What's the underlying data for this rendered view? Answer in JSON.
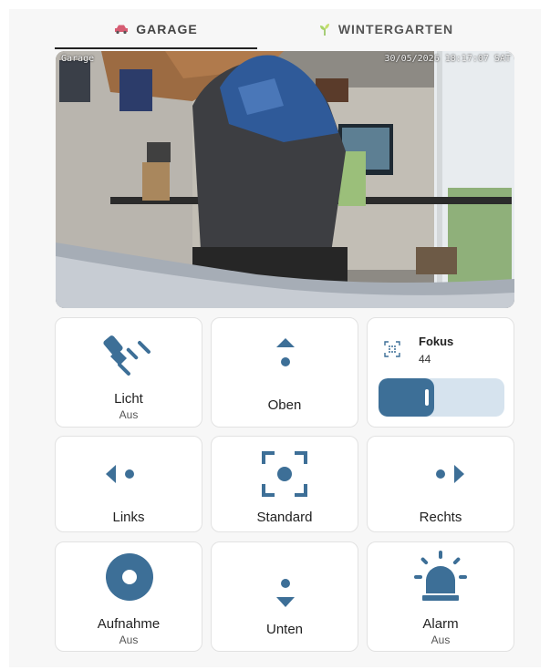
{
  "tabs": [
    {
      "label": "GARAGE",
      "icon": "car-icon",
      "active": true
    },
    {
      "label": "WINTERGARTEN",
      "icon": "plant-icon",
      "active": false
    }
  ],
  "camera": {
    "name": "Garage",
    "timestamp": "30/05/2026 18:17:07 SAT"
  },
  "controls": {
    "licht": {
      "label": "Licht",
      "state": "Aus",
      "icon": "flashlight-icon"
    },
    "oben": {
      "label": "Oben",
      "icon": "arrow-up-icon"
    },
    "fokus": {
      "label": "Fokus",
      "value": "44",
      "icon": "focus-icon",
      "level_percent": 44
    },
    "links": {
      "label": "Links",
      "icon": "arrow-left-icon"
    },
    "standard": {
      "label": "Standard",
      "icon": "crosshair-icon"
    },
    "rechts": {
      "label": "Rechts",
      "icon": "arrow-right-icon"
    },
    "aufnahme": {
      "label": "Aufnahme",
      "state": "Aus",
      "icon": "record-icon"
    },
    "unten": {
      "label": "Unten",
      "icon": "arrow-down-icon"
    },
    "alarm": {
      "label": "Alarm",
      "state": "Aus",
      "icon": "siren-icon"
    }
  },
  "colors": {
    "accent": "#3d6f97",
    "slider_track": "#d6e3ee"
  }
}
